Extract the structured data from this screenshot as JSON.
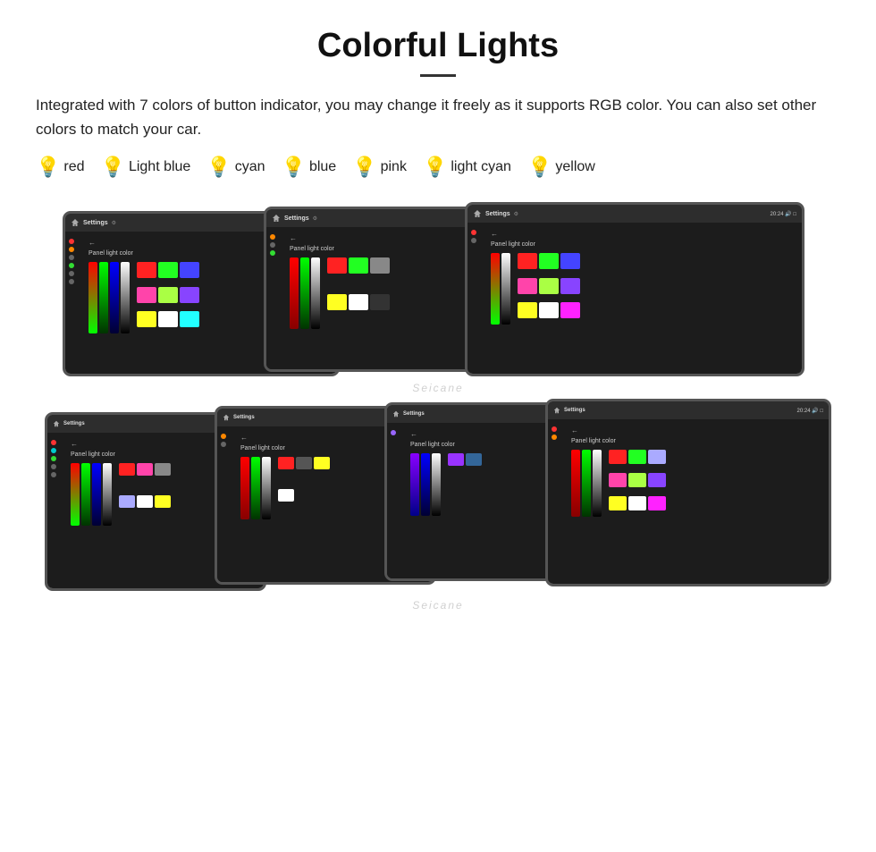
{
  "page": {
    "title": "Colorful Lights",
    "description": "Integrated with 7 colors of button indicator, you may change it freely as it supports RGB color. You can also set other colors to match your car.",
    "colors": [
      {
        "name": "red",
        "color": "#ff2222",
        "emoji": "🔴"
      },
      {
        "name": "Light blue",
        "color": "#aaddff",
        "emoji": "💡"
      },
      {
        "name": "cyan",
        "color": "#00ffff",
        "emoji": "💡"
      },
      {
        "name": "blue",
        "color": "#4488ff",
        "emoji": "💡"
      },
      {
        "name": "pink",
        "color": "#ff44cc",
        "emoji": "💡"
      },
      {
        "name": "light cyan",
        "color": "#aaffff",
        "emoji": "💡"
      },
      {
        "name": "yellow",
        "color": "#ffff44",
        "emoji": "💡"
      }
    ],
    "watermark": "Seicane",
    "screen_label": "Panel light color",
    "settings_label": "Settings",
    "time_label": "20:24"
  }
}
